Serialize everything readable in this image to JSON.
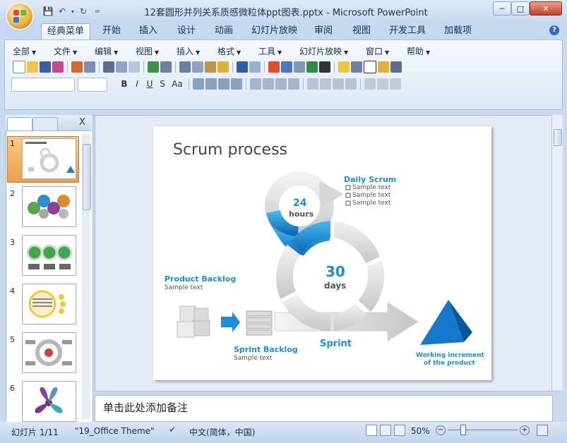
{
  "window": {
    "title": "12套圆形并列关系质感微粒体ppt图表.pptx - Microsoft PowerPoint",
    "minimize": "─",
    "maximize": "□",
    "close": "✕"
  },
  "quick_access": {
    "dropdown": "="
  },
  "tabs": [
    "经典菜单",
    "开始",
    "插入",
    "设计",
    "动画",
    "幻灯片放映",
    "审阅",
    "视图",
    "开发工具",
    "加载项"
  ],
  "help_label": "?",
  "menu": [
    "全部",
    "文件",
    "编辑",
    "视图",
    "插入",
    "格式",
    "工具",
    "幻灯片放映",
    "窗口",
    "帮助"
  ],
  "format_buttons": {
    "bold": "B",
    "italic": "I",
    "underline": "U",
    "shadow": "S",
    "case": "Aa"
  },
  "panel": {
    "close_label": "X"
  },
  "slides": {
    "numbers": [
      "1",
      "2",
      "3",
      "4",
      "5",
      "6"
    ]
  },
  "slide": {
    "title": "Scrum process",
    "daily_scrum": {
      "title": "Daily Scrum",
      "items": [
        "Sample text",
        "Sample text",
        "Sample text"
      ]
    },
    "hours_value": "24",
    "hours_label": "hours",
    "days_value": "30",
    "days_label": "days",
    "product_backlog": {
      "title": "Product Backlog",
      "subtitle": "Sample text"
    },
    "sprint_backlog": {
      "title": "Sprint Backlog",
      "subtitle": "Sample text"
    },
    "sprint_label": "Sprint",
    "increment_label_1": "Working increment",
    "increment_label_2": "of the product"
  },
  "notes_placeholder": "单击此处添加备注",
  "status": {
    "slide_info": "幻灯片 1/11",
    "theme": "\"19_Office Theme\"",
    "language": "中文(简体，中国)",
    "zoom": "50%"
  },
  "colors": {
    "accent": "#1a9ad9",
    "title_bar": "#c6d8ef"
  }
}
